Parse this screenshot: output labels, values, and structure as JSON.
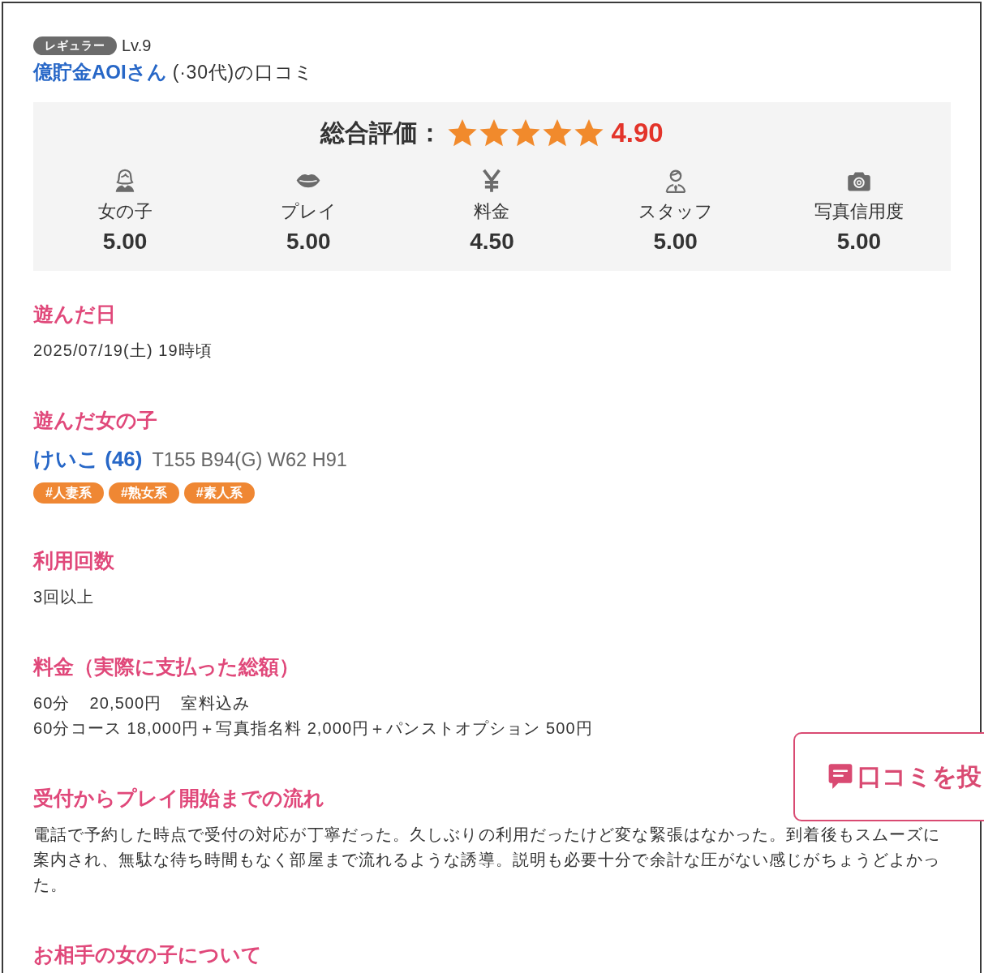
{
  "reviewer": {
    "rank": "レギュラー",
    "level": "Lv.9",
    "name": "億貯金AOIさん",
    "suffix": "(·30代)の口コミ"
  },
  "rating": {
    "label": "総合評価：",
    "stars": 5,
    "score": "4.90",
    "categories": [
      {
        "kind": "girl",
        "label": "女の子",
        "score": "5.00"
      },
      {
        "kind": "play",
        "label": "プレイ",
        "score": "5.00"
      },
      {
        "kind": "price",
        "label": "料金",
        "score": "4.50"
      },
      {
        "kind": "staff",
        "label": "スタッフ",
        "score": "5.00"
      },
      {
        "kind": "photo",
        "label": "写真信用度",
        "score": "5.00"
      }
    ]
  },
  "sections": [
    {
      "kind": "text",
      "heading": "遊んだ日",
      "lines": [
        "2025/07/19(土) 19時頃"
      ]
    },
    {
      "kind": "girl",
      "heading": "遊んだ女の子",
      "girl": {
        "name": "けいこ (46)",
        "measurements": "T155 B94(G) W62 H91",
        "tags": [
          "#人妻系",
          "#熟女系",
          "#素人系"
        ]
      }
    },
    {
      "kind": "text",
      "heading": "利用回数",
      "lines": [
        "3回以上"
      ]
    },
    {
      "kind": "price",
      "heading": "料金（実際に支払った総額）",
      "items": [
        "60分",
        "20,500円",
        "室料込み"
      ],
      "lines": [
        "60分コース 18,000円＋写真指名料 2,000円＋パンストオプション 500円"
      ]
    },
    {
      "kind": "paragraph",
      "heading": "受付からプレイ開始までの流れ",
      "text": "電話で予約した時点で受付の対応が丁寧だった。久しぶりの利用だったけど変な緊張はなかった。到着後もスムーズに案内され、無駄な待ち時間もなく部屋まで流れるような誘導。説明も必要十分で余計な圧がない感じがちょうどよかった。"
    },
    {
      "kind": "text",
      "heading": "お相手の女の子について"
    }
  ],
  "post_button": {
    "label": "口コミを投"
  }
}
